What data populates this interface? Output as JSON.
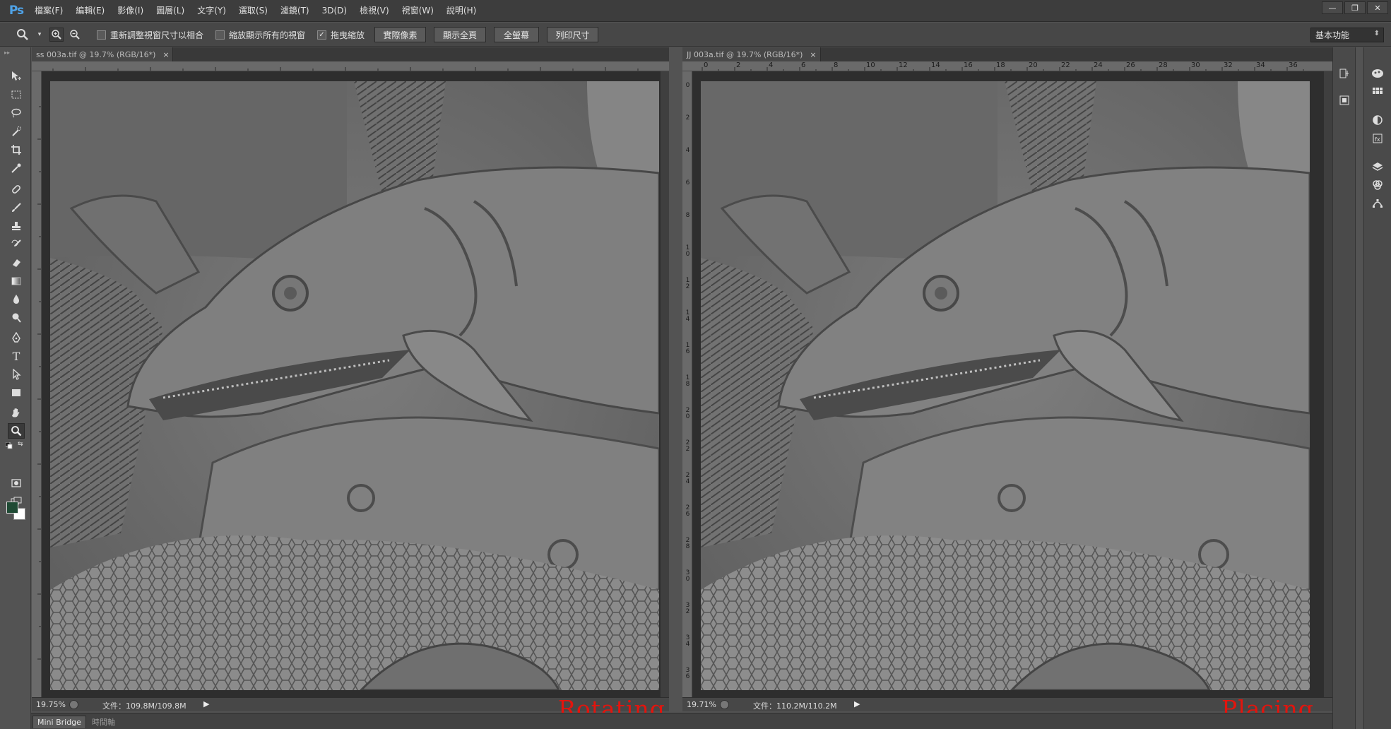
{
  "app": {
    "logo": "Ps"
  },
  "menu": [
    "檔案(F)",
    "編輯(E)",
    "影像(I)",
    "圖層(L)",
    "文字(Y)",
    "選取(S)",
    "濾鏡(T)",
    "3D(D)",
    "檢視(V)",
    "視窗(W)",
    "說明(H)"
  ],
  "window_controls": {
    "minimize": "—",
    "restore": "❐",
    "close": "✕"
  },
  "options": {
    "resize_windows_label": "重新調整視窗尺寸以相合",
    "resize_windows_checked": false,
    "zoom_all_label": "縮放顯示所有的視窗",
    "zoom_all_checked": false,
    "scrubby_zoom_label": "拖曳縮放",
    "scrubby_zoom_checked": true,
    "actual_pixels": "實際像素",
    "fit_screen": "顯示全頁",
    "fill_screen": "全螢幕",
    "print_size": "列印尺寸",
    "workspace": "基本功能"
  },
  "documents": [
    {
      "tab": "ss 003a.tif @ 19.7% (RGB/16*)",
      "zoom": "19.75%",
      "info": "文件：109.8M/109.8M",
      "overlay": "Rotating"
    },
    {
      "tab": "JJ 003a.tif @ 19.7% (RGB/16*)",
      "zoom": "19.71%",
      "info": "文件：110.2M/110.2M",
      "overlay": "Placing",
      "ruler_h": [
        "0",
        "2",
        "4",
        "6",
        "8",
        "10",
        "12",
        "14",
        "16",
        "18",
        "20",
        "22",
        "24",
        "26",
        "28",
        "30",
        "32",
        "34",
        "36"
      ],
      "ruler_v": [
        "0",
        "2",
        "4",
        "6",
        "8",
        "10",
        "12",
        "14",
        "16",
        "18",
        "20",
        "22",
        "24",
        "26",
        "28",
        "30",
        "32",
        "34",
        "36"
      ]
    }
  ],
  "bottom_tabs": [
    "Mini Bridge",
    "時間軸"
  ],
  "colors": {
    "foreground": "#1f4a34",
    "background": "#ffffff",
    "overlay_text": "#e3140d"
  }
}
